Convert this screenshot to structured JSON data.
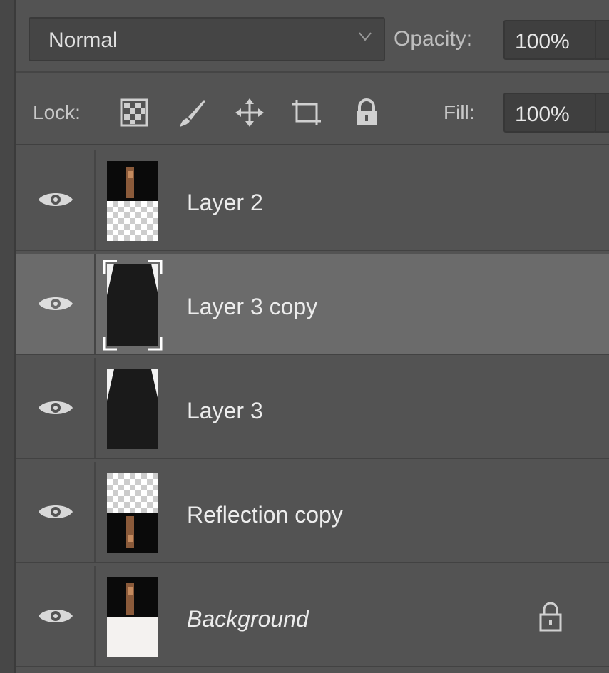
{
  "blend": {
    "mode": "Normal",
    "opacity_label": "Opacity:",
    "opacity_value": "100%"
  },
  "lock": {
    "label": "Lock:",
    "icons": [
      "lock-transparent-pixels-icon",
      "lock-image-pixels-icon",
      "lock-position-icon",
      "lock-artboard-icon",
      "lock-all-icon"
    ],
    "fill_label": "Fill:",
    "fill_value": "100%"
  },
  "layers": [
    {
      "name": "Layer 2",
      "visible": true,
      "selected": false,
      "locked": false
    },
    {
      "name": "Layer 3 copy",
      "visible": true,
      "selected": true,
      "locked": false
    },
    {
      "name": "Layer 3",
      "visible": true,
      "selected": false,
      "locked": false
    },
    {
      "name": "Reflection copy",
      "visible": true,
      "selected": false,
      "locked": false
    },
    {
      "name": "Background",
      "visible": true,
      "selected": false,
      "locked": true
    }
  ],
  "colors": {
    "panel": "#535353",
    "selected_row": "#6b6b6b",
    "text": "#ececec"
  }
}
